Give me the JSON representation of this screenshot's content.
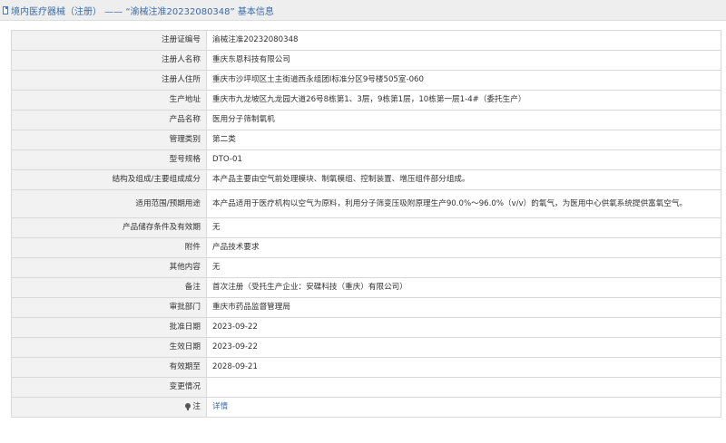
{
  "header": {
    "title": "境内医疗器械（注册） —— “渝械注准20232080348” 基本信息"
  },
  "rows": [
    {
      "label": "注册证编号",
      "value": "渝械注准20232080348"
    },
    {
      "label": "注册人名称",
      "value": "重庆东恩科技有限公司"
    },
    {
      "label": "注册人住所",
      "value": "重庆市沙坪坝区土主街道西永组团I标准分区9号楼505室-060"
    },
    {
      "label": "生产地址",
      "value": "重庆市九龙坡区九龙园大道26号8栋第1、3层，9栋第1层，10栋第一层1-4#（委托生产）"
    },
    {
      "label": "产品名称",
      "value": "医用分子筛制氧机"
    },
    {
      "label": "管理类别",
      "value": "第二类"
    },
    {
      "label": "型号规格",
      "value": "DTO-01"
    },
    {
      "label": "结构及组成/主要组成成分",
      "value": "本产品主要由空气前处理模块、制氧模组、控制装置、增压组件部分组成。"
    },
    {
      "label": "适用范围/预期用途",
      "value": "本产品适用于医疗机构以空气为原料，利用分子筛变压吸附原理生产90.0%～96.0%（v/v）的氧气，为医用中心供氧系统提供富氧空气。"
    },
    {
      "label": "产品储存条件及有效期",
      "value": "无"
    },
    {
      "label": "附件",
      "value": "产品技术要求"
    },
    {
      "label": "其他内容",
      "value": "无"
    },
    {
      "label": "备注",
      "value": "首次注册（受托生产企业：安碟科技（重庆）有限公司）"
    },
    {
      "label": "审批部门",
      "value": "重庆市药品监督管理局"
    },
    {
      "label": "批准日期",
      "value": "2023-09-22"
    },
    {
      "label": "生效日期",
      "value": "2023-09-22"
    },
    {
      "label": "有效期至",
      "value": "2028-09-21"
    },
    {
      "label": "变更情况",
      "value": ""
    }
  ],
  "footer_row": {
    "label": "注",
    "link": "详情",
    "icon": "pin-icon"
  }
}
